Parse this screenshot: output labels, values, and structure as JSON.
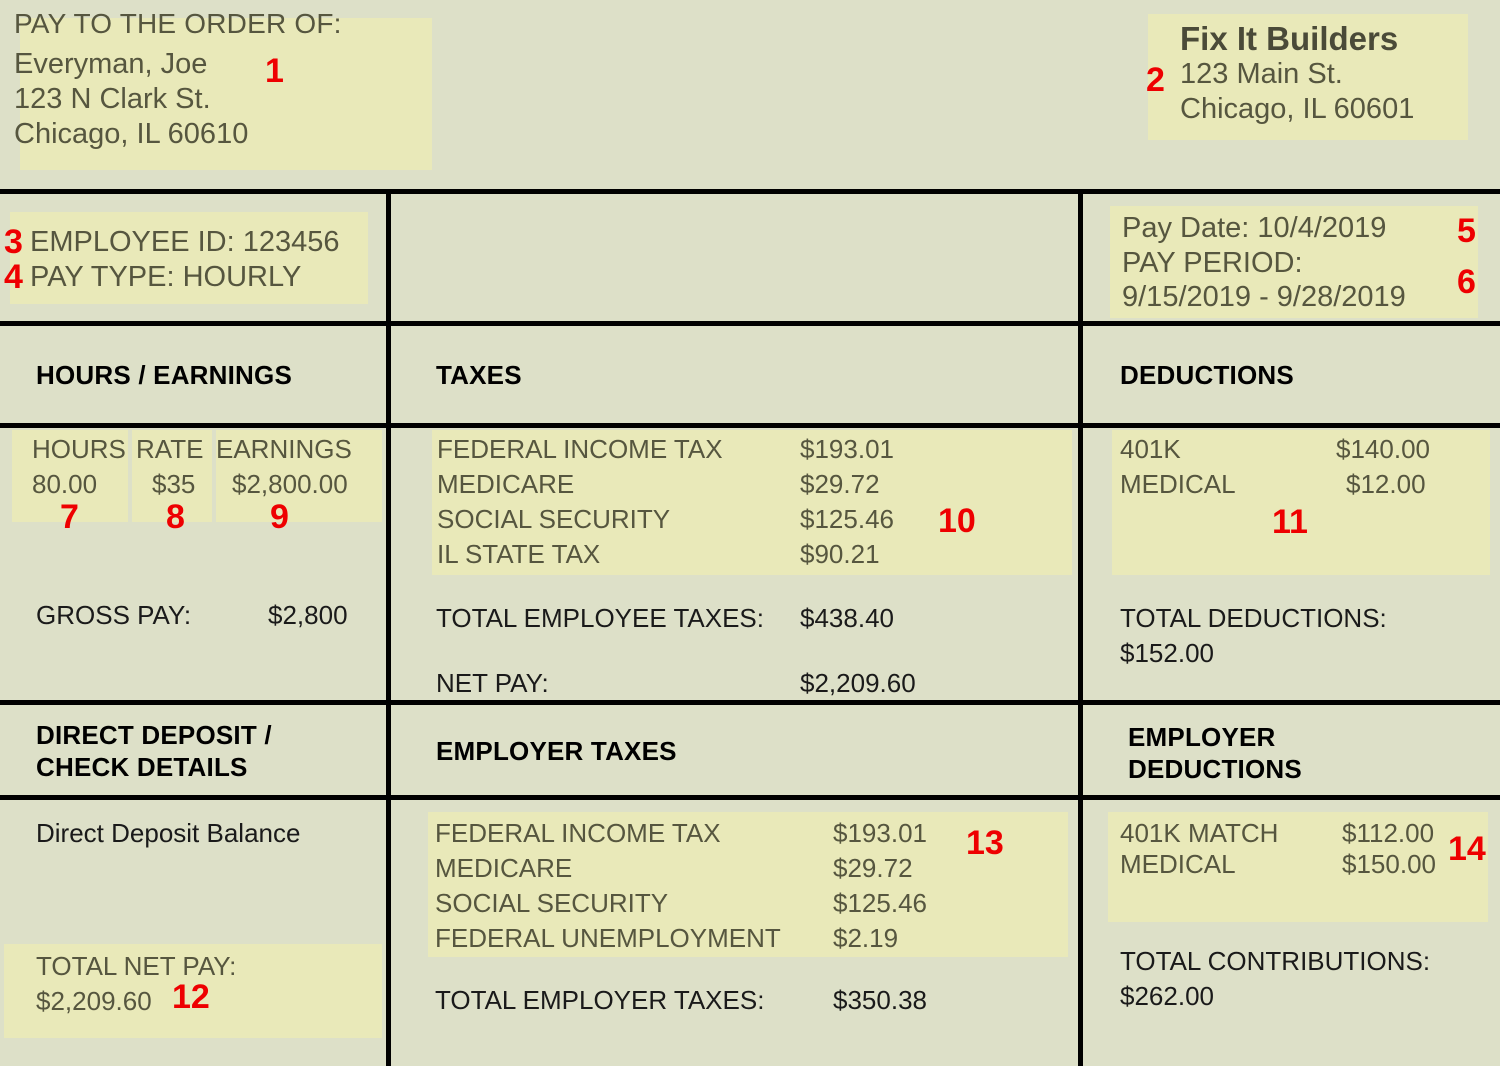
{
  "payee": {
    "label": "PAY TO THE ORDER OF:",
    "name": "Everyman, Joe",
    "address_line1": "123 N Clark St.",
    "address_line2": "Chicago, IL 60610"
  },
  "employer": {
    "name": "Fix It Builders",
    "address_line1": "123 Main St.",
    "address_line2": "Chicago, IL 60601"
  },
  "identity": {
    "employee_id_line": "EMPLOYEE ID: 123456",
    "pay_type_line": "PAY TYPE: HOURLY"
  },
  "pay_dates": {
    "pay_date_line": "Pay Date: 10/4/2019",
    "pay_period_label": "PAY PERIOD:",
    "pay_period_range": "9/15/2019 - 9/28/2019"
  },
  "sections": {
    "hours_earnings": "HOURS / EARNINGS",
    "taxes": "TAXES",
    "deductions": "DEDUCTIONS",
    "direct_deposit": "DIRECT DEPOSIT /\nCHECK DETAILS",
    "direct_deposit_l1": "DIRECT DEPOSIT /",
    "direct_deposit_l2": "CHECK DETAILS",
    "employer_taxes": "EMPLOYER TAXES",
    "employer_deductions_l1": "EMPLOYER",
    "employer_deductions_l2": "DEDUCTIONS"
  },
  "hours_earnings": {
    "headers": [
      "HOURS",
      "RATE",
      "EARNINGS"
    ],
    "row": [
      "80.00",
      "$35",
      "$2,800.00"
    ],
    "gross_pay_label": "GROSS PAY:",
    "gross_pay_value": "$2,800"
  },
  "employee_taxes": {
    "items": [
      {
        "name": "FEDERAL INCOME TAX",
        "amount": "$193.01"
      },
      {
        "name": "MEDICARE",
        "amount": "$29.72"
      },
      {
        "name": "SOCIAL SECURITY",
        "amount": "$125.46"
      },
      {
        "name": "IL STATE TAX",
        "amount": "$90.21"
      }
    ],
    "total_label": "TOTAL EMPLOYEE TAXES:",
    "total_value": "$438.40",
    "net_pay_label": "NET PAY:",
    "net_pay_value": "$2,209.60"
  },
  "deductions": {
    "items": [
      {
        "name": "401K",
        "amount": "$140.00"
      },
      {
        "name": "MEDICAL",
        "amount": "$12.00"
      }
    ],
    "total_label": "TOTAL DEDUCTIONS:",
    "total_value": "$152.00"
  },
  "direct_deposit": {
    "balance_label": "Direct Deposit Balance",
    "total_net_pay_label": "TOTAL NET PAY:",
    "total_net_pay_value": "$2,209.60"
  },
  "employer_taxes": {
    "items": [
      {
        "name": "FEDERAL INCOME TAX",
        "amount": "$193.01"
      },
      {
        "name": "MEDICARE",
        "amount": "$29.72"
      },
      {
        "name": "SOCIAL SECURITY",
        "amount": "$125.46"
      },
      {
        "name": "FEDERAL UNEMPLOYMENT",
        "amount": "$2.19"
      }
    ],
    "total_label": "TOTAL EMPLOYER TAXES:",
    "total_value": "$350.38"
  },
  "employer_deductions": {
    "items": [
      {
        "name": "401K MATCH",
        "amount": "$112.00"
      },
      {
        "name": "MEDICAL",
        "amount": "$150.00"
      }
    ],
    "total_label": "TOTAL CONTRIBUTIONS:",
    "total_value": "$262.00"
  },
  "markers": {
    "m1": "1",
    "m2": "2",
    "m3": "3",
    "m4": "4",
    "m5": "5",
    "m6": "6",
    "m7": "7",
    "m8": "8",
    "m9": "9",
    "m10": "10",
    "m11": "11",
    "m12": "12",
    "m13": "13",
    "m14": "14"
  },
  "colors": {
    "page_background": "#dde0c8",
    "highlight": "#e9e9b9",
    "marker_red": "#ee0000",
    "rule_black": "#000000",
    "body_text": "#56563f"
  }
}
